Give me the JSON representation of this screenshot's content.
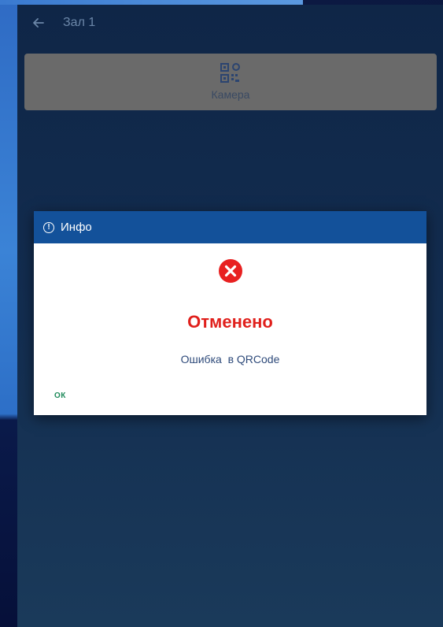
{
  "appbar": {
    "back_icon": "arrow-left-icon",
    "title": "Зал 1"
  },
  "camera_button": {
    "icon": "qr-code-icon",
    "label": "Камера"
  },
  "dialog": {
    "header_icon": "info-circle-icon",
    "title": "Инфо",
    "status_icon": "error-x-circle-icon",
    "status": "Отменено",
    "message": "Ошибка  в QRCode",
    "ok_label": "ОК"
  },
  "colors": {
    "dialog_header": "#13519a",
    "status_red": "#e0201c",
    "ok_green": "#1e8a5a",
    "camera_button_bg": "#6a6a6a"
  }
}
